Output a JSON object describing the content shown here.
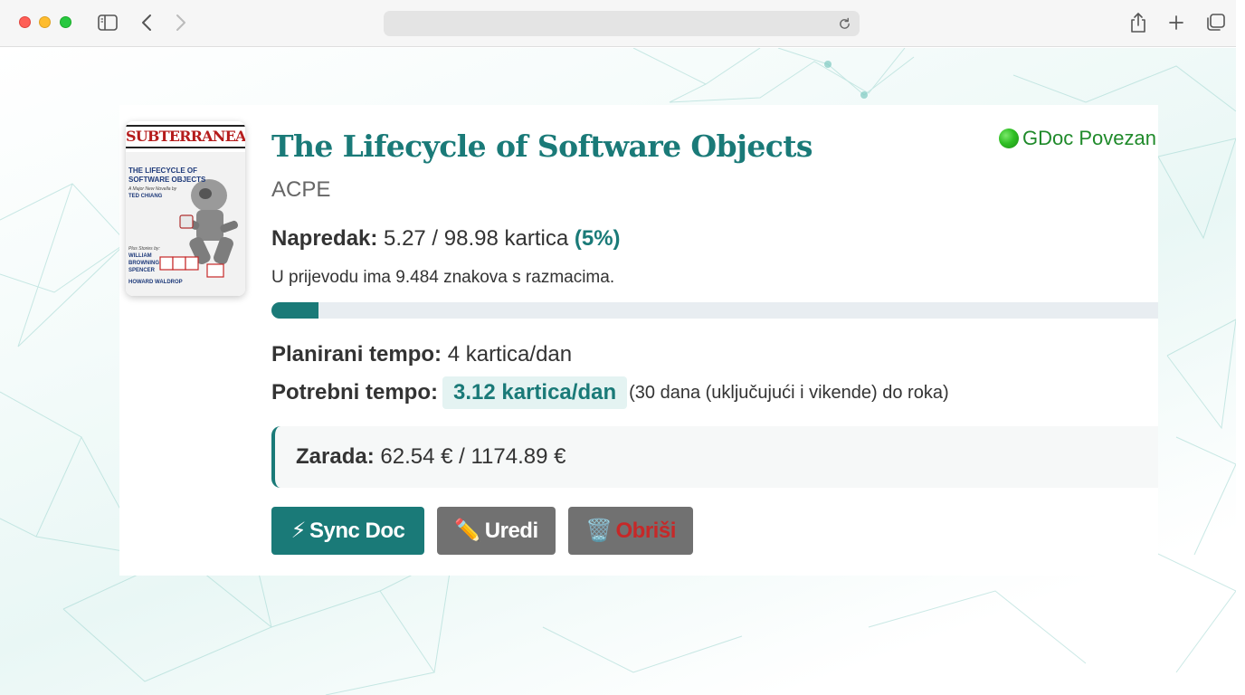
{
  "browser": {
    "address_text": ""
  },
  "book": {
    "title": "The Lifecycle of Software Objects",
    "client": "ACPE",
    "cover": {
      "publisher_logo": "SUBTERRANEAN",
      "title": "THE LIFECYCLE OF SOFTWARE OBJECTS",
      "tagline": "A Major New Novella by",
      "author": "TED CHIANG",
      "plus_label": "Plus Stories by:",
      "other_authors": [
        "WILLIAM BROWNING SPENCER",
        "HOWARD WALDROP"
      ]
    }
  },
  "gdoc": {
    "status_label": "GDoc Povezan",
    "status_color": "#2fbf24"
  },
  "progress": {
    "label": "Napredak:",
    "value": "5.27 / 98.98 kartica",
    "percent_label": "(5%)",
    "fraction": 0.0532,
    "chars_text": "U prijevodu ima 9.484 znakova s razmacima."
  },
  "tempo": {
    "planned_label": "Planirani tempo:",
    "planned_value": "4 kartica/dan",
    "needed_label": "Potrebni tempo:",
    "needed_value": "3.12 kartica/dan",
    "needed_note": "(30 dana (uključujući i vikende) do roka)"
  },
  "earnings": {
    "label": "Zarada:",
    "value": "62.54 € / 1174.89 €"
  },
  "buttons": {
    "sync": {
      "icon": "⚡",
      "label": "Sync Doc"
    },
    "edit": {
      "icon": "✏️",
      "label": "Uredi"
    },
    "delete": {
      "icon": "🗑️",
      "label": "Obriši"
    }
  },
  "colors": {
    "accent": "#1a7a78",
    "button_gray": "#717171",
    "danger": "#c62828",
    "status_green": "#1f8a2a"
  }
}
